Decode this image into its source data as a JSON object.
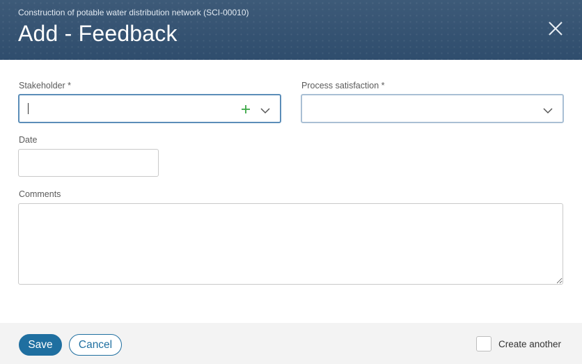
{
  "header": {
    "subtitle": "Construction of potable water distribution network (SCI-00010)",
    "title": "Add - Feedback",
    "close_icon": "close-icon"
  },
  "form": {
    "stakeholder": {
      "label": "Stakeholder *",
      "value": "",
      "add_icon": "plus-icon",
      "dropdown_icon": "chevron-down-icon"
    },
    "process_satisfaction": {
      "label": "Process satisfaction *",
      "value": "",
      "dropdown_icon": "chevron-down-icon"
    },
    "date": {
      "label": "Date",
      "value": ""
    },
    "comments": {
      "label": "Comments",
      "value": ""
    }
  },
  "footer": {
    "save_label": "Save",
    "cancel_label": "Cancel",
    "create_another_label": "Create another",
    "create_another_checked": false
  },
  "colors": {
    "header_bg": "#2f4d6d",
    "primary": "#1f6fa0",
    "add_green": "#3aa845",
    "footer_bg": "#f3f3f3"
  }
}
